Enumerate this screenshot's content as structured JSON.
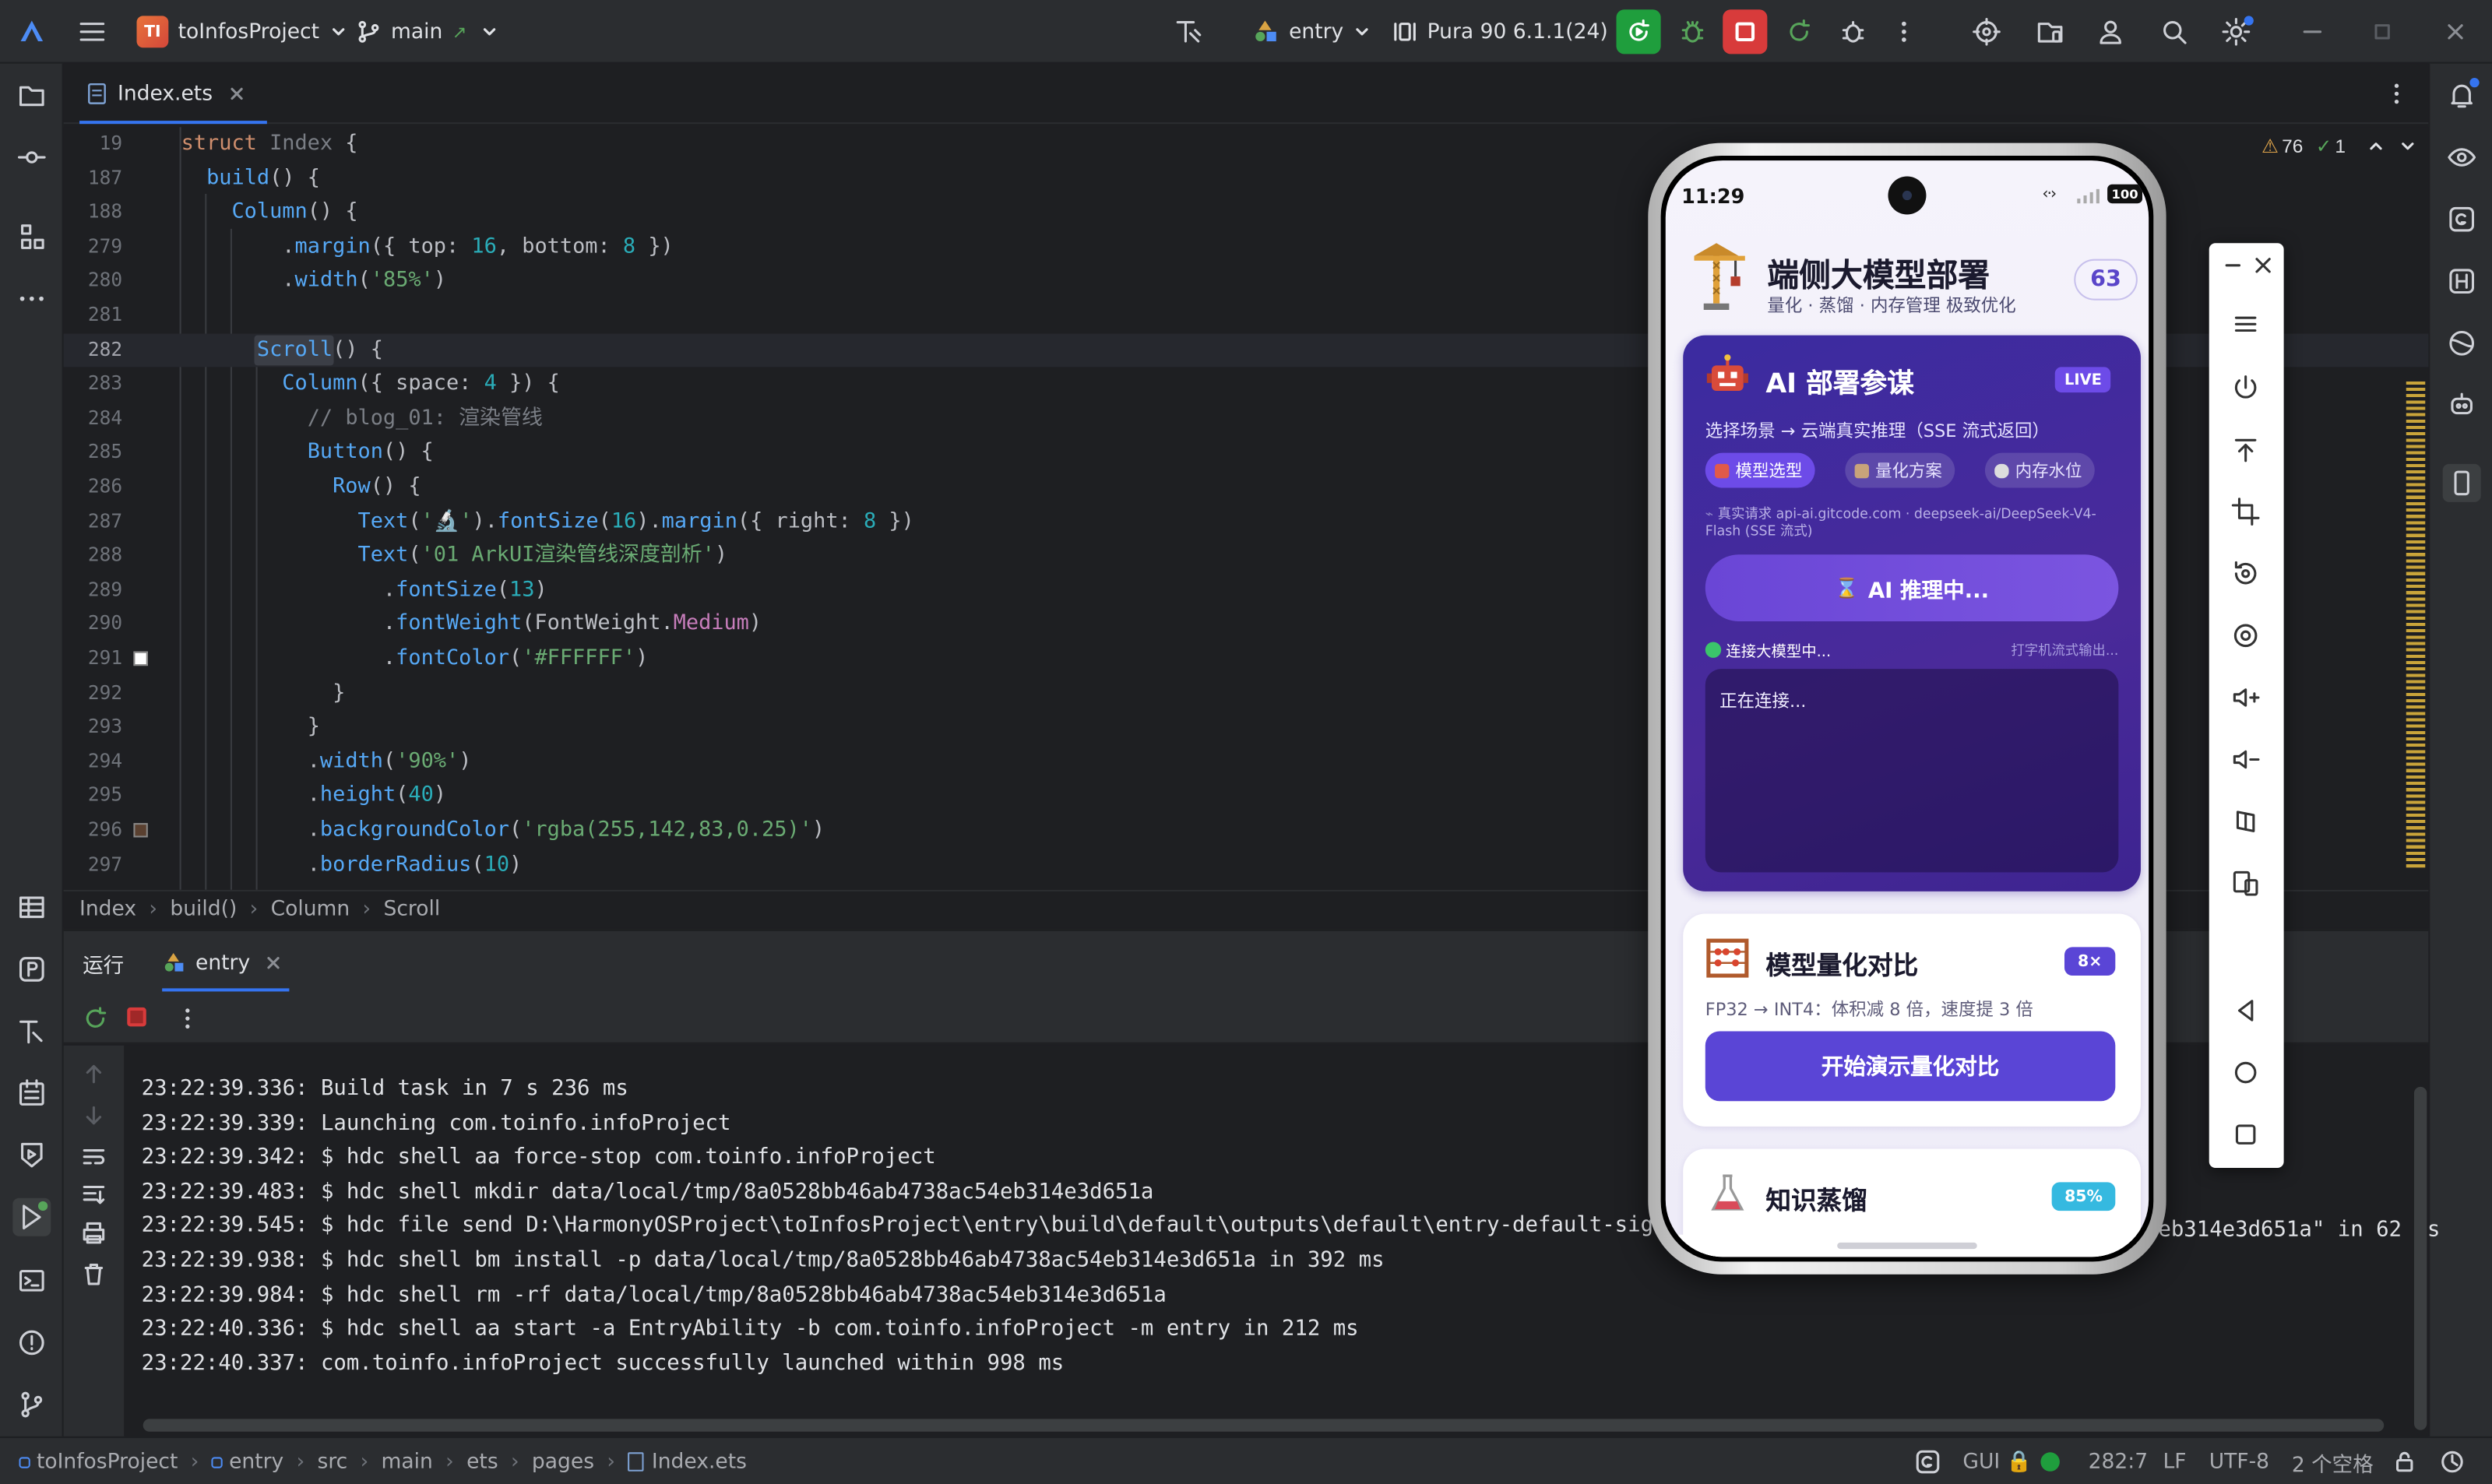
{
  "titlebar": {
    "project_initials": "TI",
    "project_name": "toInfosProject",
    "branch": "main",
    "run_config": "entry",
    "device": "Pura 90 6.1.1(24)"
  },
  "editor": {
    "tab": "Index.ets",
    "warnings": "76",
    "checks": "1",
    "lines": [
      {
        "n": "19",
        "html": "<span class='k'>struct </span><span class='dim'>Index </span><span class='t'>{</span>"
      },
      {
        "n": "187",
        "html": "  <span class='m'>build</span><span class='t'>() {</span>"
      },
      {
        "n": "188",
        "html": "    <span class='m'>Column</span><span class='t'>() {</span>"
      },
      {
        "n": "279",
        "html": "        <span class='t'>.</span><span class='m'>margin</span><span class='t'>({ top: </span><span class='n'>16</span><span class='t'>, bottom: </span><span class='n'>8</span><span class='t'> })</span>"
      },
      {
        "n": "280",
        "html": "        <span class='t'>.</span><span class='m'>width</span><span class='t'>(</span><span class='s'>'85%'</span><span class='t'>)</span>"
      },
      {
        "n": "281",
        "html": ""
      },
      {
        "n": "282",
        "html": "      <span class='m'>Scroll</span><span class='t'>() {</span>",
        "cur": true
      },
      {
        "n": "283",
        "html": "        <span class='m'>Column</span><span class='t'>({ space: </span><span class='n'>4</span><span class='t'> }) {</span>"
      },
      {
        "n": "284",
        "html": "          <span class='c'>// blog_01: 渲染管线</span>"
      },
      {
        "n": "285",
        "html": "          <span class='m'>Button</span><span class='t'>() {</span>"
      },
      {
        "n": "286",
        "html": "            <span class='m'>Row</span><span class='t'>() {</span>"
      },
      {
        "n": "287",
        "html": "              <span class='m'>Text</span><span class='t'>(</span><span class='s'>'🔬'</span><span class='t'>).</span><span class='m'>fontSize</span><span class='t'>(</span><span class='n'>16</span><span class='t'>).</span><span class='m'>margin</span><span class='t'>({ right: </span><span class='n'>8</span><span class='t'> })</span>"
      },
      {
        "n": "288",
        "html": "              <span class='m'>Text</span><span class='t'>(</span><span class='s'>'01 ArkUI渲染管线深度剖析'</span><span class='t'>)</span>"
      },
      {
        "n": "289",
        "html": "                <span class='t'>.</span><span class='m'>fontSize</span><span class='t'>(</span><span class='n'>13</span><span class='t'>)</span>"
      },
      {
        "n": "290",
        "html": "                <span class='t'>.</span><span class='m'>fontWeight</span><span class='t'>(FontWeight.</span><span class='f'>Medium</span><span class='t'>)</span>"
      },
      {
        "n": "291",
        "html": "                <span class='t'>.</span><span class='m'>fontColor</span><span class='t'>(</span><span class='s'>'#FFFFFF'</span><span class='t'>)</span>",
        "swatch": "#FFFFFF"
      },
      {
        "n": "292",
        "html": "            <span class='t'>}</span>"
      },
      {
        "n": "293",
        "html": "          <span class='t'>}</span>"
      },
      {
        "n": "294",
        "html": "          <span class='t'>.</span><span class='m'>width</span><span class='t'>(</span><span class='s'>'90%'</span><span class='t'>)</span>"
      },
      {
        "n": "295",
        "html": "          <span class='t'>.</span><span class='m'>height</span><span class='t'>(</span><span class='n'>40</span><span class='t'>)</span>"
      },
      {
        "n": "296",
        "html": "          <span class='t'>.</span><span class='m'>backgroundColor</span><span class='t'>(</span><span class='s'>'rgba(255,142,83,0.25)'</span><span class='t'>)</span>",
        "swatch": "#5a4030"
      },
      {
        "n": "297",
        "html": "          <span class='t'>.</span><span class='m'>borderRadius</span><span class='t'>(</span><span class='n'>10</span><span class='t'>)</span>"
      }
    ],
    "breadcrumb": [
      "Index",
      "build()",
      "Column",
      "Scroll"
    ]
  },
  "run": {
    "tab_run": "运行",
    "tab_entry": "entry",
    "logs": [
      "23:22:39.336: Build task in 7 s 236 ms",
      "23:22:39.339: Launching com.toinfo.infoProject",
      "23:22:39.342: $ hdc shell aa force-stop com.toinfo.infoProject",
      "23:22:39.483: $ hdc shell mkdir data/local/tmp/8a0528bb46ab4738ac54eb314e3d651a",
      "23:22:39.545: $ hdc file send D:\\HarmonyOSProject\\toInfosProject\\entry\\build\\default\\outputs\\default\\entry-default-signed",
      "23:22:39.938: $ hdc shell bm install -p data/local/tmp/8a0528bb46ab4738ac54eb314e3d651a in 392 ms",
      "23:22:39.984: $ hdc shell rm -rf data/local/tmp/8a0528bb46ab4738ac54eb314e3d651a",
      "23:22:40.336: $ hdc shell aa start -a EntryAbility -b com.toinfo.infoProject -m entry in 212 ms",
      "23:22:40.337: com.toinfo.infoProject successfully launched within 998 ms"
    ],
    "log_tail": "eb314e3d651a\" in 62 ms"
  },
  "statusbar": {
    "path": [
      "toInfosProject",
      "entry",
      "src",
      "main",
      "ets",
      "pages",
      "Index.ets"
    ],
    "gui": "GUI",
    "position": "282:7",
    "line_sep": "LF",
    "encoding": "UTF-8",
    "indent": "2 个空格"
  },
  "phone": {
    "time": "11:29",
    "battery": "100",
    "header_title": "端侧大模型部署",
    "header_subtitle": "量化 · 蒸馏 · 内存管理 极致优化",
    "header_badge": "63",
    "ai": {
      "title": "AI 部署参谋",
      "live": "LIVE",
      "desc": "选择场景 → 云端真实推理（SSE 流式返回）",
      "chips": [
        "模型选型",
        "量化方案",
        "内存水位"
      ],
      "request_info": "真实请求 api-ai.gitcode.com · deepseek-ai/DeepSeek-V4-Flash (SSE 流式)",
      "button": "AI 推理中...",
      "status_left": "连接大模型中...",
      "status_right": "打字机流式输出...",
      "output": "正在连接..."
    },
    "quant": {
      "title": "模型量化对比",
      "badge": "8×",
      "desc": "FP32 → INT4：体积减 8 倍，速度提 3 倍",
      "button": "开始演示量化对比"
    },
    "distill": {
      "title": "知识蒸馏",
      "badge": "85%"
    }
  },
  "colors": {
    "accent": "#3574f0",
    "run_green": "#1f9e3d",
    "stop_red": "#d83b3b",
    "phone_purple": "#6d4be8"
  }
}
